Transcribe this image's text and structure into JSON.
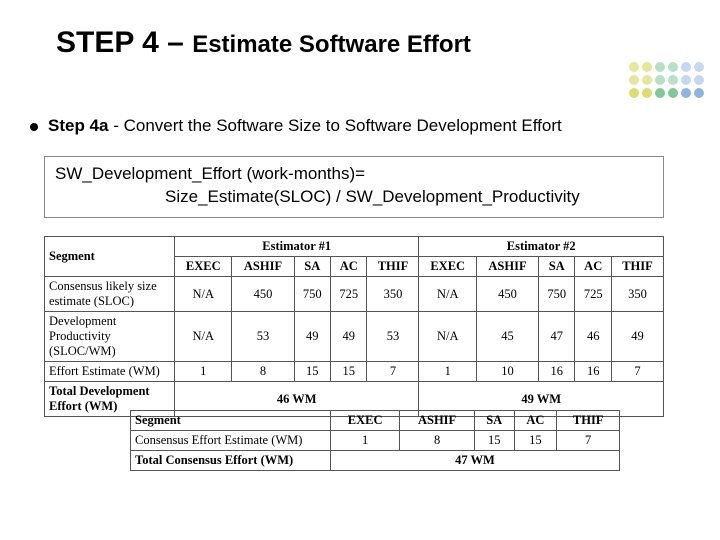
{
  "title": {
    "big": "STEP 4 – ",
    "small": "Estimate Software Effort"
  },
  "bullet": {
    "label": "Step 4a",
    "rest": " - Convert the Software Size to Software Development Effort"
  },
  "formula": {
    "line1": "SW_Development_Effort (work-months)=",
    "line2": "Size_Estimate(SLOC) / SW_Development_Productivity"
  },
  "table1": {
    "segment_hdr": "Segment",
    "group1": "Estimator #1",
    "group2": "Estimator #2",
    "cols": [
      "EXEC",
      "ASHIF",
      "SA",
      "AC",
      "THIF",
      "EXEC",
      "ASHIF",
      "SA",
      "AC",
      "THIF"
    ],
    "rows": [
      {
        "label": "Consensus likely size estimate (SLOC)",
        "v": [
          "N/A",
          "450",
          "750",
          "725",
          "350",
          "N/A",
          "450",
          "750",
          "725",
          "350"
        ]
      },
      {
        "label": "Development Productivity (SLOC/WM)",
        "v": [
          "N/A",
          "53",
          "49",
          "49",
          "53",
          "N/A",
          "45",
          "47",
          "46",
          "49"
        ]
      },
      {
        "label": "Effort Estimate (WM)",
        "v": [
          "1",
          "8",
          "15",
          "15",
          "7",
          "1",
          "10",
          "16",
          "16",
          "7"
        ]
      }
    ],
    "total_label": "Total Development Effort (WM)",
    "total1": "46 WM",
    "total2": "49 WM"
  },
  "table2": {
    "segment_hdr": "Segment",
    "cols": [
      "EXEC",
      "ASHIF",
      "SA",
      "AC",
      "THIF"
    ],
    "row": {
      "label": "Consensus Effort Estimate (WM)",
      "v": [
        "1",
        "8",
        "15",
        "15",
        "7"
      ]
    },
    "total_label": "Total Consensus Effort (WM)",
    "total": "47 WM"
  },
  "dot_colors": [
    "#e6e6a0",
    "#e6e6a0",
    "#b8e0c8",
    "#b8e0c8",
    "#c6d8ee",
    "#c6d8ee",
    "#e6e6a0",
    "#e6e6a0",
    "#b8e0c8",
    "#b8e0c8",
    "#c6d8ee",
    "#c6d8ee",
    "#dcdc70",
    "#dcdc70",
    "#7fc89a",
    "#7fc89a",
    "#8fb4df",
    "#8fb4df"
  ]
}
